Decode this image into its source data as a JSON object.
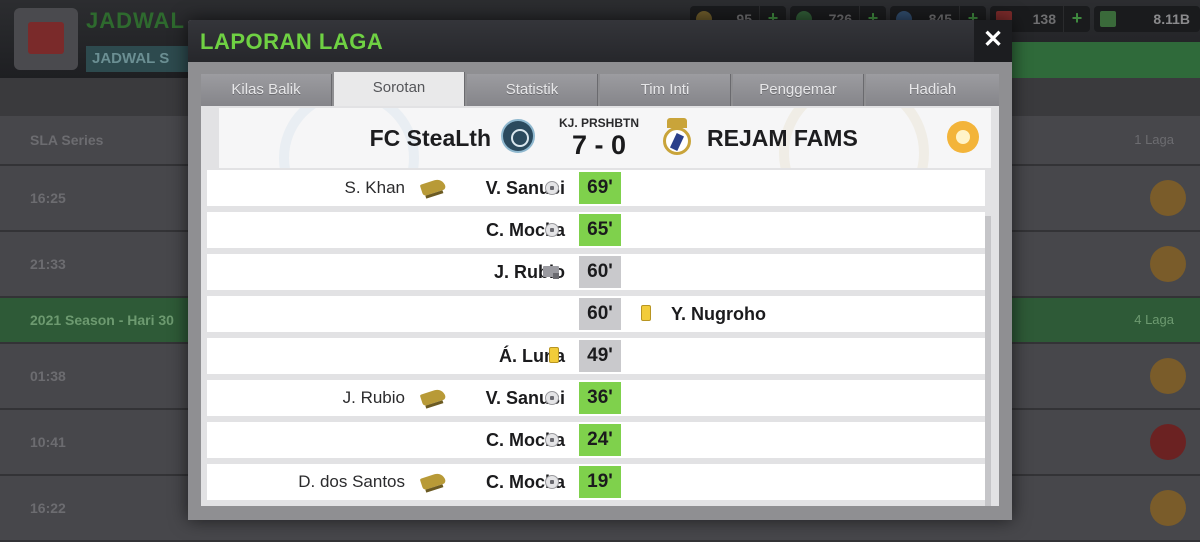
{
  "background": {
    "title": "JADWAL",
    "subtitle": "JADWAL S",
    "resources": [
      {
        "icon": "coin-icon",
        "value": "95"
      },
      {
        "icon": "ticket-icon",
        "value": "726"
      },
      {
        "icon": "boost-icon",
        "value": "845"
      },
      {
        "icon": "medical-icon",
        "value": "138"
      },
      {
        "icon": "cash-icon",
        "value": "8.11B"
      }
    ],
    "plus_label": "+",
    "rows": [
      {
        "left": "SLA Series",
        "right": "1 Laga"
      },
      {
        "left": "16:25",
        "right": ""
      },
      {
        "left": "21:33",
        "right": ""
      },
      {
        "left": "2021 Season - Hari 30",
        "right": "4 Laga"
      },
      {
        "left": "01:38",
        "right": ""
      },
      {
        "left": "10:41",
        "right": ""
      },
      {
        "left": "16:22",
        "right": ""
      }
    ]
  },
  "modal": {
    "title": "LAPORAN LAGA",
    "close_label": "✕"
  },
  "tabs": [
    {
      "label": "Kilas Balik",
      "active": false
    },
    {
      "label": "Sorotan",
      "active": true
    },
    {
      "label": "Statistik",
      "active": false
    },
    {
      "label": "Tim Inti",
      "active": false
    },
    {
      "label": "Penggemar",
      "active": false
    },
    {
      "label": "Hadiah",
      "active": false
    }
  ],
  "scoreboard": {
    "home_team": "FC SteaLth",
    "away_team": "REJAM FAMS",
    "competition": "KJ. PRSHBTN",
    "score": "7 - 0",
    "weather": "sunny-icon"
  },
  "events": [
    {
      "side": "home",
      "assist": "S. Khan",
      "player": "V. Sanusi",
      "type": "goal",
      "minute": "69'"
    },
    {
      "side": "home",
      "assist": "",
      "player": "C. Mocka",
      "type": "goal",
      "minute": "65'"
    },
    {
      "side": "home",
      "assist": "",
      "player": "J. Rubio",
      "type": "var",
      "minute": "60'"
    },
    {
      "side": "away",
      "assist": "",
      "player": "Y. Nugroho",
      "type": "yellow-card",
      "minute": "60'"
    },
    {
      "side": "home",
      "assist": "",
      "player": "Á. Luna",
      "type": "yellow-card",
      "minute": "49'"
    },
    {
      "side": "home",
      "assist": "J. Rubio",
      "player": "V. Sanusi",
      "type": "goal",
      "minute": "36'"
    },
    {
      "side": "home",
      "assist": "",
      "player": "C. Mocka",
      "type": "goal",
      "minute": "24'"
    },
    {
      "side": "home",
      "assist": "D. dos Santos",
      "player": "C. Mocka",
      "type": "goal",
      "minute": "19'"
    }
  ],
  "colors": {
    "title_green": "#6fd143",
    "goal_minute": "#7fd14c",
    "other_minute": "#c9c9cc"
  }
}
